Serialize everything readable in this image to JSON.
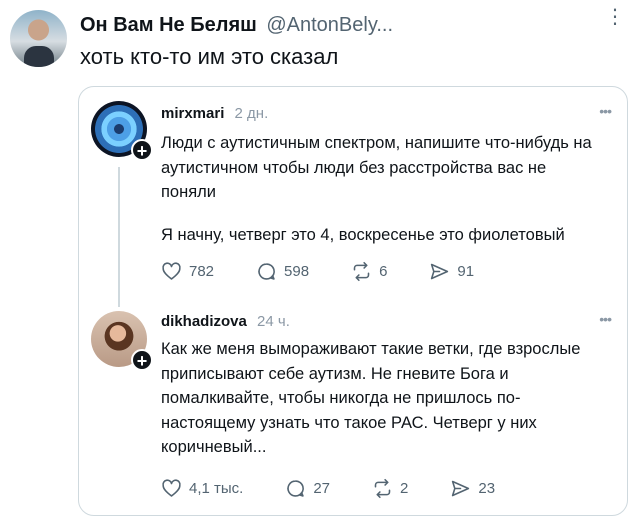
{
  "header": {
    "name": "Он Вам Не Беляш",
    "handle": "@AntonBely...",
    "text": "хоть кто-то им это сказал"
  },
  "posts": [
    {
      "username": "mirxmari",
      "time": "2 дн.",
      "paragraphs": [
        "Люди с аутистичным спектром, напишите что-нибудь на аутистичном чтобы люди без расстройства вас не поняли",
        "Я начну, четверг это 4, воскресенье это фиолетовый"
      ],
      "likes": "782",
      "replies": "598",
      "reposts": "6",
      "shares": "91"
    },
    {
      "username": "dikhadizova",
      "time": "24 ч.",
      "paragraphs": [
        "Как же меня вымораживают такие ветки, где взрослые приписывают себе аутизм. Не гневите Бога и помалкивайте, чтобы никогда не пришлось по-настоящему узнать что такое РАС. Четверг у них коричневый..."
      ],
      "likes": "4,1 тыс.",
      "replies": "27",
      "reposts": "2",
      "shares": "23"
    }
  ]
}
